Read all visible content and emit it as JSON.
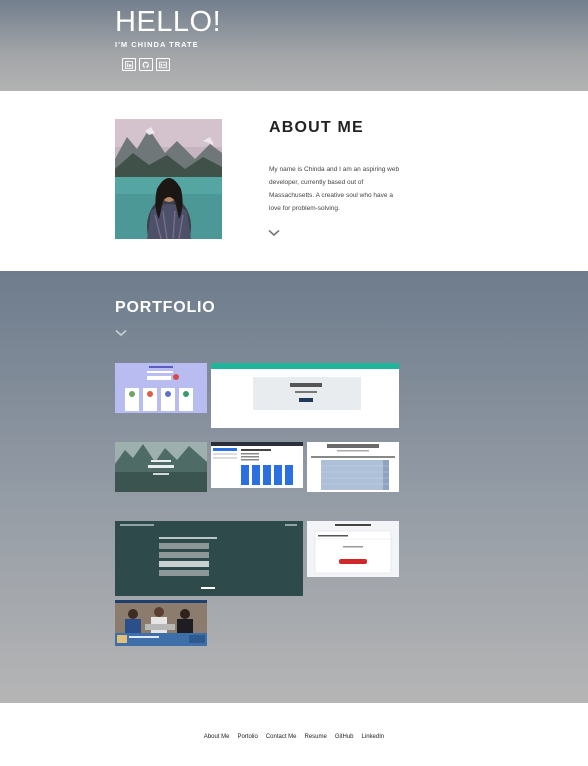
{
  "header": {
    "title": "HELLO!",
    "subtitle": "I'M CHINDA TRATE",
    "social_icons": [
      "linkedin-icon",
      "github-icon",
      "resume-icon"
    ]
  },
  "about": {
    "title": "ABOUT ME",
    "text": "My name is Chinda and I am an aspiring web developer, currently based out of Massachusetts. A creative soul who have a love for problem-solving."
  },
  "portfolio": {
    "title": "PORTFOLIO",
    "projects": [
      {
        "id": "p1",
        "theme": "#b7bcf0"
      },
      {
        "id": "p2",
        "label": "Meta Tokens",
        "theme": "#1fb59a"
      },
      {
        "id": "p3",
        "label": "Travel",
        "theme": "#5c7f78"
      },
      {
        "id": "p4",
        "label": "Weather Dashboard",
        "theme": "#2c6fe0"
      },
      {
        "id": "p5",
        "label": "Work Day Scheduler",
        "theme": "#aebfd8"
      },
      {
        "id": "p6",
        "label": "Quiz",
        "theme": "#2f4a4b"
      },
      {
        "id": "p7",
        "label": "Password Generator",
        "theme": "#d02828"
      },
      {
        "id": "p8",
        "theme": "#3e6fa8"
      }
    ]
  },
  "footer": {
    "links": [
      "About Me",
      "Portolio",
      "Contact Me",
      "Resume",
      "GitHub",
      "LinkedIn"
    ]
  },
  "colors": {
    "header_gradient_top": "#727f8d",
    "portfolio_gradient_top": "#6e7c8c",
    "footer_bg": "#ffffff"
  }
}
